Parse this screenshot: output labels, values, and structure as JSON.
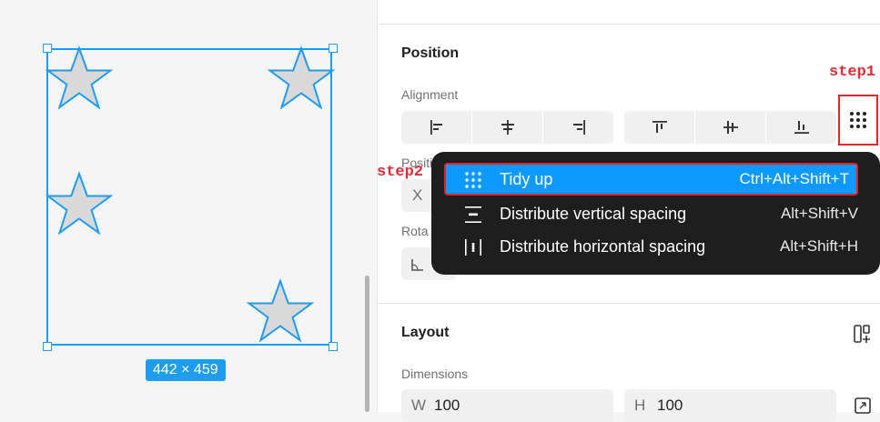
{
  "canvas": {
    "size_badge": "442 × 459"
  },
  "panel": {
    "position_title": "Position",
    "alignment_label": "Alignment",
    "position_label": "Positi",
    "x_label": "X",
    "rotation_label": "Rota",
    "layout_title": "Layout",
    "dimensions_label": "Dimensions",
    "w_label": "W",
    "w_value": "100",
    "h_label": "H",
    "h_value": "100"
  },
  "annotations": {
    "step1": "step1",
    "step2": "step2"
  },
  "menu": {
    "items": [
      {
        "label": "Tidy up",
        "shortcut": "Ctrl+Alt+Shift+T",
        "icon": "tidy-grid-icon"
      },
      {
        "label": "Distribute vertical spacing",
        "shortcut": "Alt+Shift+V",
        "icon": "distribute-vertical-icon"
      },
      {
        "label": "Distribute horizontal spacing",
        "shortcut": "Alt+Shift+H",
        "icon": "distribute-horizontal-icon"
      }
    ]
  },
  "colors": {
    "selection": "#1e9cf0",
    "highlight": "#0d99ff",
    "annotation": "#e5222e",
    "menu_bg": "#1e1e1e"
  }
}
